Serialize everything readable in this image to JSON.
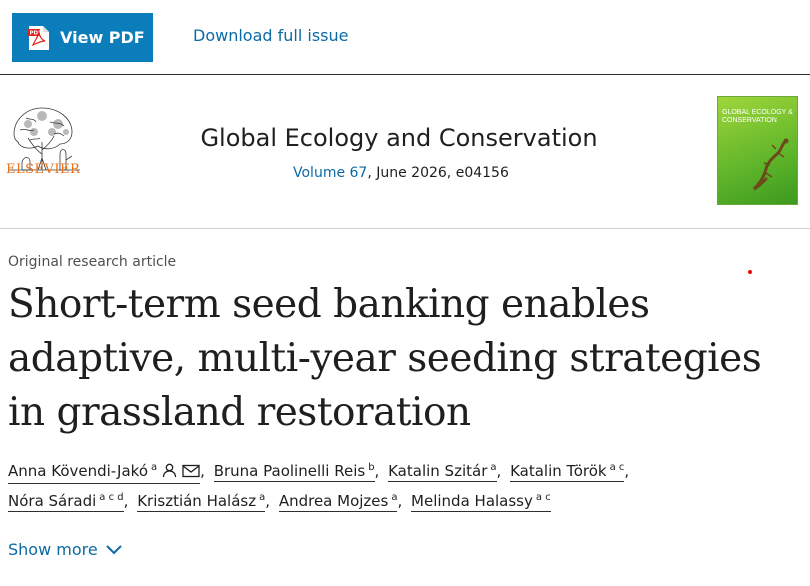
{
  "toolbar": {
    "view_pdf_label": "View PDF",
    "download_label": "Download full issue"
  },
  "journal": {
    "publisher": "ELSEVIER",
    "title": "Global Ecology and Conservation",
    "volume_link": "Volume 67",
    "volume_rest": ", June 2026, e04156",
    "cover_text": "GLOBAL ECOLOGY & CONSERVATION"
  },
  "article": {
    "type": "Original research article",
    "title": "Short-term seed banking enables adaptive, multi-year seeding strategies in grassland restoration"
  },
  "authors": [
    {
      "name": "Anna Kövendi-Jakó",
      "aff": "a"
    },
    {
      "name": "Bruna Paolinelli Reis",
      "aff": "b"
    },
    {
      "name": "Katalin Szitár",
      "aff": "a"
    },
    {
      "name": "Katalin Török",
      "aff": "a c"
    },
    {
      "name": "Nóra Sáradi",
      "aff": "a c d"
    },
    {
      "name": "Krisztián Halász",
      "aff": "a"
    },
    {
      "name": "Andrea Mojzes",
      "aff": "a"
    },
    {
      "name": "Melinda Halassy",
      "aff": "a c"
    }
  ],
  "show_more_label": "Show more",
  "colors": {
    "accent": "#0c7dbb",
    "link": "#0c6aa6",
    "publisher": "#e9711c",
    "cover": "#5fb52a"
  },
  "icons": {
    "pdf": "pdf-icon",
    "person": "person-icon",
    "email": "email-icon",
    "chevron": "chevron-down-icon",
    "tree": "elsevier-tree-logo"
  }
}
